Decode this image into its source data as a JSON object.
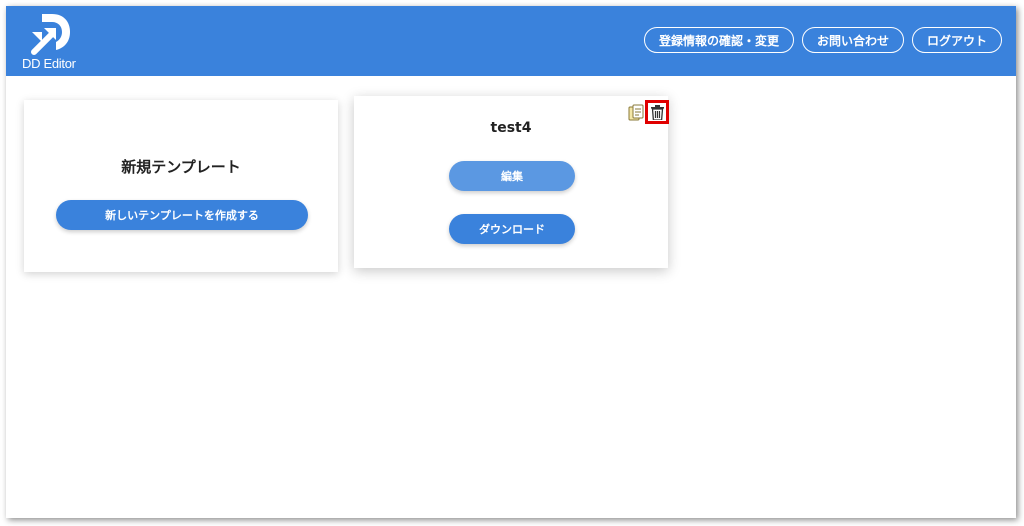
{
  "header": {
    "logo_text": "DD Editor",
    "brand_color": "#3a82dc",
    "nav": [
      {
        "label": "登録情報の確認・変更"
      },
      {
        "label": "お問い合わせ"
      },
      {
        "label": "ログアウト"
      }
    ]
  },
  "new_template_card": {
    "title": "新規テンプレート",
    "create_button": "新しいテンプレートを作成する"
  },
  "template_card": {
    "title": "test4",
    "edit_button": "編集",
    "download_button": "ダウンロード",
    "icons": [
      "copy-icon",
      "trash-icon"
    ],
    "highlight_color": "#e00000"
  }
}
